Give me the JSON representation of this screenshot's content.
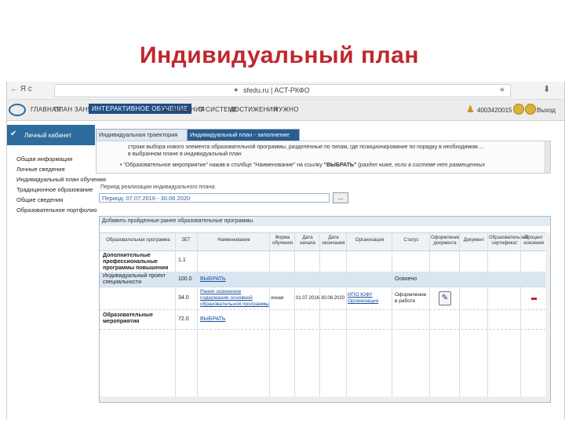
{
  "slide": {
    "title": "Индивидуальный план"
  },
  "browser": {
    "nav": "← Я   c",
    "url": "sfedu.ru | ACT-РКФО",
    "lock": "●",
    "star": "★",
    "download": "⬇"
  },
  "header": {
    "menu": [
      "ГЛАВНАЯ",
      "ПЛАН ЗАНЯТИЙ",
      "ИНТЕРАКТИВНОЕ ОБУЧЕНИЕ",
      "СООБЩЕНИЯ",
      "О СИСТЕМЕ",
      "ДОСТИЖЕНИЯ",
      "НУЖНО"
    ],
    "user_id": "4003420015",
    "exit": "Выход"
  },
  "sidebar": {
    "cabinet": "Личный кабинет",
    "items": [
      "Общая информация",
      "Личные сведения",
      "Индивидуальный план обучения",
      "Традиционное образование",
      "Общие сведения",
      "Образовательное портфолио"
    ]
  },
  "tabs": [
    "Индивидуальная траектория",
    "Индивидуальный план - заполнение"
  ],
  "notes": {
    "l1": "строки выбора нового элемента образовательной программы, разделенные по типам, где позиционирование по порядку в необходимом ...",
    "l2": "в выбранном плане в индивидуальный план",
    "l3a": "\"Образовательное мероприятие\"",
    "l3b": " нажав в столбце \"Наименование\" на ссылку ",
    "l3c": "\"ВЫБРАТЬ\"",
    "l3d": " (раздел ниже, если в системе нет размещенных"
  },
  "period": {
    "label": "Период реализации индивидуального плана:",
    "value": "Период: 07.07.2016 - 30.06.2020",
    "button": "..."
  },
  "panel": {
    "title": "Добавить пройденные ранее образовательные программы",
    "columns": [
      "Образовательная программа",
      "ЗЕТ",
      "Наименование",
      "Форма обучения",
      "Дата начала",
      "Дата окончания",
      "Организация",
      "Статус",
      "Оформление документа",
      "Документ",
      "Образовательный сертификат",
      "Процент освоения"
    ],
    "rows": [
      {
        "program": "Дополнительные профессиональные программы повышения",
        "zet": "1.1",
        "name": "",
        "form": "",
        "start": "",
        "end": "",
        "org": "",
        "status": ""
      },
      {
        "program": "Индивидуальный проект специальности",
        "zet": "100.0",
        "name": "ВЫБРАТЬ",
        "form": "",
        "start": "",
        "end": "",
        "org": "",
        "status": "Освоено"
      },
      {
        "program": "",
        "zet": "34.0",
        "name": "Ранее освоенное содержание основной образовательной программы",
        "form": "очная",
        "start": "01.07.2016",
        "end": "30.06.2020",
        "org": "ИПО ЮФУ Организация",
        "status": "Оформление в работе"
      },
      {
        "program": "Образовательные мероприятия",
        "zet": "72.0",
        "name": "ВЫБРАТЬ",
        "form": "",
        "start": "",
        "end": "",
        "org": "",
        "status": ""
      }
    ]
  }
}
